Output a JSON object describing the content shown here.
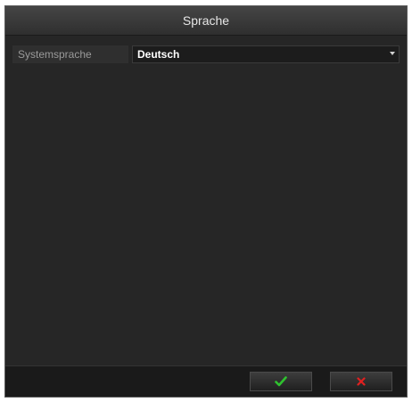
{
  "dialog": {
    "title": "Sprache"
  },
  "settings": {
    "system_language_label": "Systemsprache",
    "system_language_value": "Deutsch"
  },
  "footer": {
    "ok_icon": "checkmark-icon",
    "cancel_icon": "close-icon"
  },
  "colors": {
    "ok_icon": "#2fc22f",
    "cancel_icon": "#e02020",
    "panel": "#262626",
    "title_text": "#e6e6e6"
  }
}
